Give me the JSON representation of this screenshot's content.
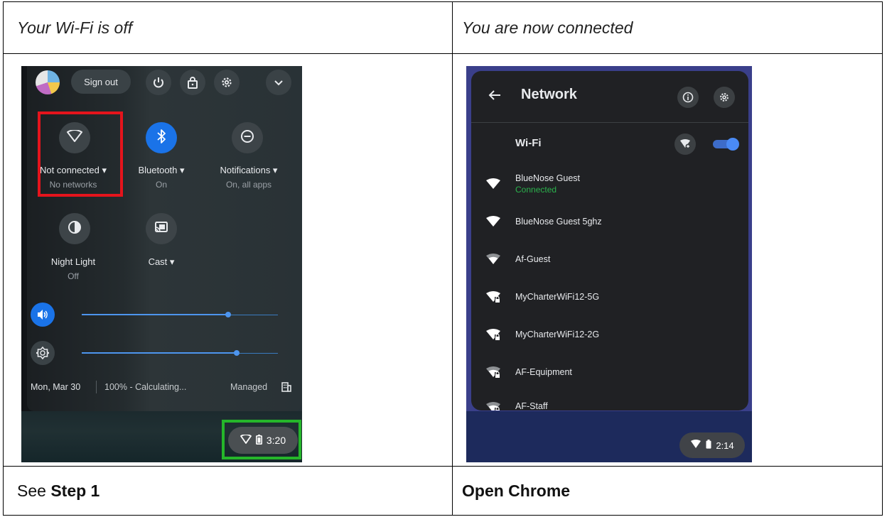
{
  "table": {
    "left_header": "Your Wi-Fi is off",
    "right_header": "You are now connected",
    "left_footer_prefix": "See ",
    "left_footer_bold": "Step 1",
    "right_footer_bold": "Open Chrome"
  },
  "quick_settings": {
    "sign_out_label": "Sign out",
    "icons": [
      "power-icon",
      "lock-icon",
      "gear-icon",
      "chevron-down-icon"
    ],
    "tiles": [
      {
        "name": "wifi",
        "label": "Not connected ▾",
        "sublabel": "No networks",
        "icon": "wifi-off-icon",
        "active": false
      },
      {
        "name": "bluetooth",
        "label": "Bluetooth ▾",
        "sublabel": "On",
        "icon": "bluetooth-icon",
        "active": true
      },
      {
        "name": "notifications",
        "label": "Notifications ▾",
        "sublabel": "On, all apps",
        "icon": "do-not-disturb-icon",
        "active": false
      },
      {
        "name": "night-light",
        "label": "Night Light",
        "sublabel": "Off",
        "icon": "night-light-icon",
        "active": false
      },
      {
        "name": "cast",
        "label": "Cast ▾",
        "sublabel": "",
        "icon": "cast-icon",
        "active": false
      }
    ],
    "volume_level": 0.75,
    "brightness_level": 0.79,
    "date": "Mon, Mar 30",
    "battery_status": "100% - Calculating...",
    "managed_label": "Managed",
    "clock": "3:20",
    "highlight_colors": {
      "wifi_tile": "#e5141c",
      "status_area": "#25b62a"
    }
  },
  "network": {
    "title": "Network",
    "wifi_label": "Wi-Fi",
    "wifi_enabled": true,
    "networks": [
      {
        "name": "BlueNose Guest",
        "status": "Connected",
        "secured": false
      },
      {
        "name": "BlueNose Guest 5ghz",
        "status": "",
        "secured": false
      },
      {
        "name": "Af-Guest",
        "status": "",
        "secured": false
      },
      {
        "name": "MyCharterWiFi12-5G",
        "status": "",
        "secured": true
      },
      {
        "name": "MyCharterWiFi12-2G",
        "status": "",
        "secured": true
      },
      {
        "name": "AF-Equipment",
        "status": "",
        "secured": true
      },
      {
        "name": "AF-Staff",
        "status": "",
        "secured": true
      }
    ],
    "clock": "2:14",
    "accent_color": "#4a8af4",
    "connected_color": "#2bb24c"
  }
}
